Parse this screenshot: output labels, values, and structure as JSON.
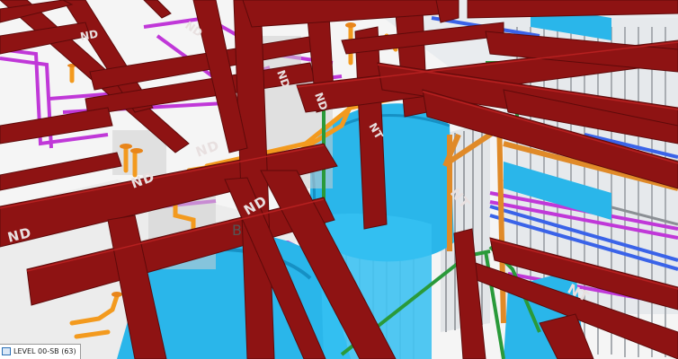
{
  "viewport": {
    "level_label": "LEVEL 00-SB (63)",
    "tags": {
      "nd": "ND",
      "nt": "NT",
      "grid_b": "B"
    }
  },
  "colors": {
    "steel_beam": "#8e1313",
    "steel_beam_dark": "#6a0c0c",
    "duct": "#2ab6ea",
    "duct_dark": "#1690c4",
    "pipe_orange": "#f39a1e",
    "pipe_magenta": "#c038d8",
    "pipe_blue": "#3a63e8",
    "framing_green": "#2a9a3a",
    "stud_grey": "#b9b9b9",
    "slab": "#f4f4f4"
  }
}
